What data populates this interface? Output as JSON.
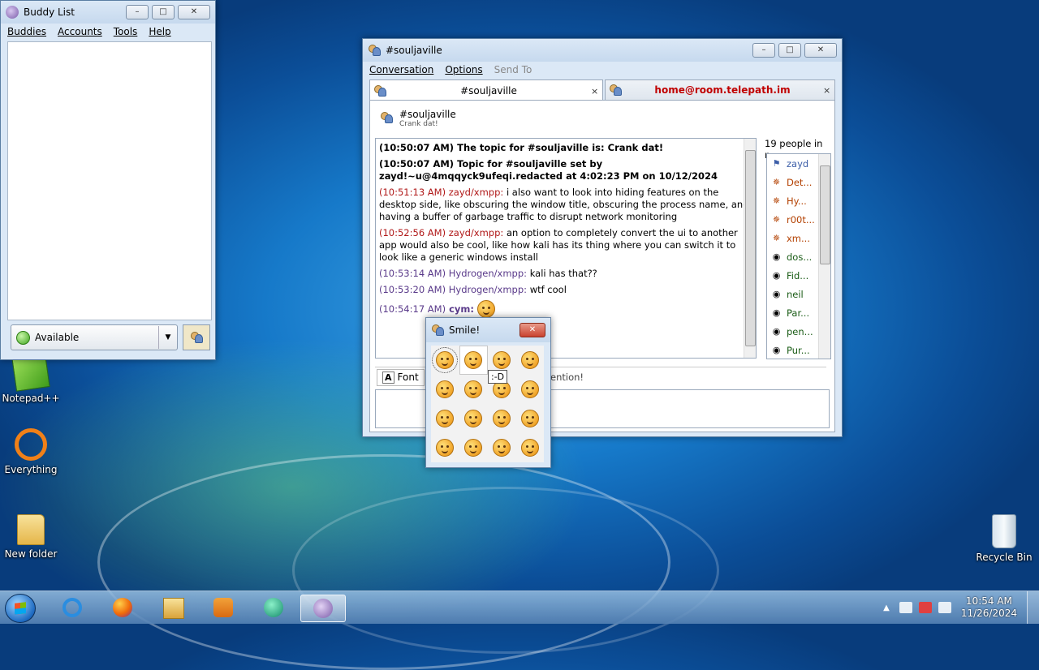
{
  "desktop": {
    "icons": {
      "notepad": "Notepad++",
      "everything": "Everything",
      "new_folder": "New folder",
      "recycle_bin": "Recycle Bin"
    }
  },
  "buddy_list": {
    "title": "Buddy List",
    "menu": [
      "Buddies",
      "Accounts",
      "Tools",
      "Help"
    ],
    "status": "Available",
    "status_color": "#3fa51f"
  },
  "chat": {
    "title": "#souljaville",
    "menu": [
      "Conversation",
      "Options",
      "Send To"
    ],
    "tabs": [
      {
        "label": "#souljaville",
        "close": "×"
      },
      {
        "label": "home@room.telepath.im",
        "close": "×"
      }
    ],
    "room_name": "#souljaville",
    "room_topic": "Crank dat!",
    "messages": [
      {
        "time": "(10:50:07 AM)",
        "text": "The topic for #souljaville is: Crank dat!"
      },
      {
        "time": "(10:50:07 AM)",
        "text": "Topic for #souljaville set by zayd!~u@4mqqyck9ufeqi.redacted at 4:02:23 PM on 10/12/2024"
      },
      {
        "time": "(10:51:13 AM)",
        "sender": "zayd/xmpp:",
        "text": "i also want to look into hiding features on the desktop side, like obscuring the window title, obscuring the process name, and having a buffer of garbage traffic to disrupt network monitoring"
      },
      {
        "time": "(10:52:56 AM)",
        "sender": "zayd/xmpp:",
        "text": "an option to completely convert the ui to another app would also be cool, like how kali has its thing where you can switch it to look like a generic windows install"
      },
      {
        "time": "(10:53:14 AM)",
        "sender": "Hydrogen/xmpp:",
        "text": "kali has that??"
      },
      {
        "time": "(10:53:20 AM)",
        "sender": "Hydrogen/xmpp:",
        "text": "wtf cool"
      },
      {
        "time": "(10:54:17 AM)",
        "sender": "cym:"
      }
    ],
    "people_count": "19 people in r...",
    "people": [
      {
        "name": "zayd",
        "role": "op"
      },
      {
        "name": "Det...",
        "role": "voiced"
      },
      {
        "name": "Hy...",
        "role": "voiced"
      },
      {
        "name": "r00t...",
        "role": "voiced"
      },
      {
        "name": "xm...",
        "role": "voiced"
      },
      {
        "name": "dos...",
        "role": "normal"
      },
      {
        "name": "Fid...",
        "role": "normal"
      },
      {
        "name": "neil",
        "role": "normal"
      },
      {
        "name": "Par...",
        "role": "normal"
      },
      {
        "name": "pen...",
        "role": "normal"
      },
      {
        "name": "Pur...",
        "role": "normal"
      }
    ],
    "font_button": "Font",
    "attention_text": "ention!"
  },
  "smile_popup": {
    "title": "Smile!",
    "tooltip": ":-D"
  },
  "taskbar": {
    "time": "10:54 AM",
    "date": "11/26/2024"
  }
}
